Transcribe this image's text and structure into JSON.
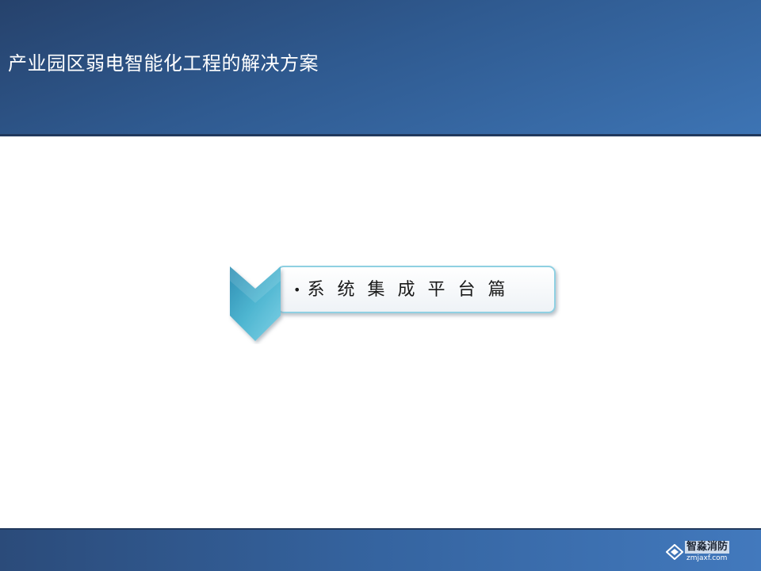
{
  "header": {
    "title": "产业园区弱电智能化工程的解决方案",
    "bg_color": "#2f5a90"
  },
  "callout": {
    "bullet": "•",
    "text": "系统集成平台篇",
    "accent_color": "#4fb6d1",
    "icon": "chevron-down-icon"
  },
  "footer": {
    "bg_color": "#3564a0"
  },
  "watermark": {
    "name": "智淼消防",
    "url": "zmjaxf.com",
    "icon": "logo-icon"
  }
}
